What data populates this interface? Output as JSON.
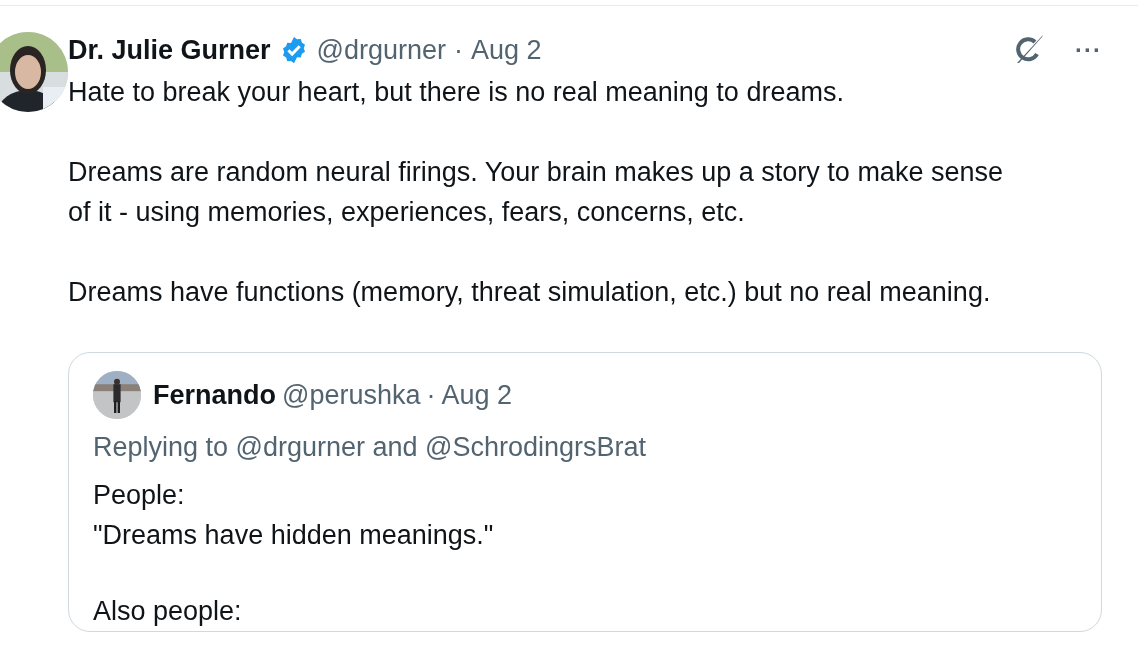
{
  "tweet": {
    "author": "Dr. Julie Gurner",
    "verified": true,
    "handle": "@drgurner",
    "separator": "·",
    "date": "Aug 2",
    "more_button": "···",
    "paragraphs": [
      "Hate to break your heart, but there is no real meaning to dreams.",
      "Dreams are random neural firings. Your brain makes up a story to make sense of it - using memories, experiences, fears, concerns, etc.",
      "Dreams have functions (memory, threat simulation, etc.) but no real meaning."
    ],
    "quote": {
      "author": "Fernando",
      "handle": "@perushka",
      "separator": "·",
      "date": "Aug 2",
      "replying_to": "Replying to @drgurner and @SchrodingrsBrat",
      "paragraphs": [
        "People:\n\"Dreams have hidden meanings.\"",
        "Also people:"
      ]
    }
  }
}
